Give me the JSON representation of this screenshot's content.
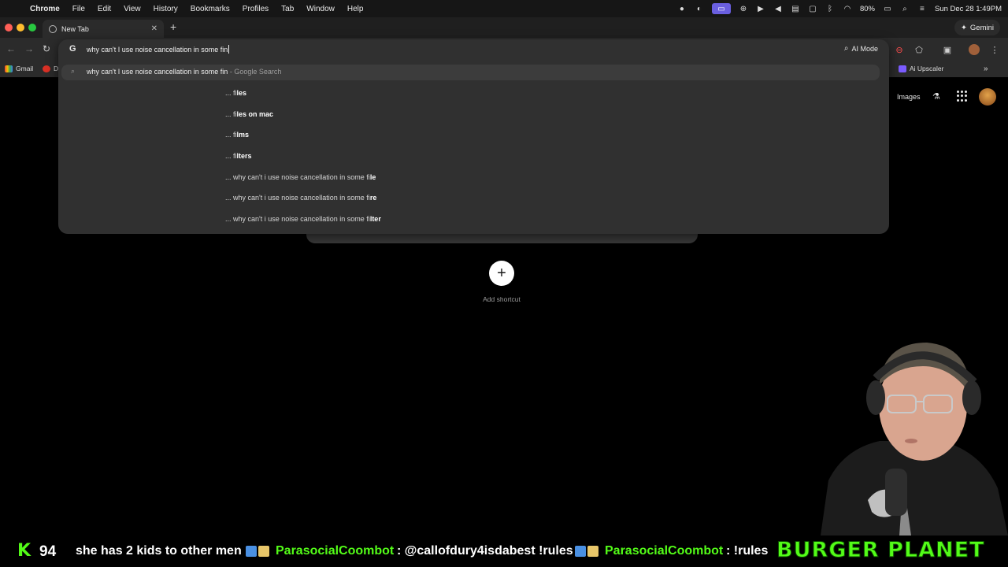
{
  "menubar": {
    "app": "Chrome",
    "items": [
      "File",
      "Edit",
      "View",
      "History",
      "Bookmarks",
      "Profiles",
      "Tab",
      "Window",
      "Help"
    ],
    "battery": "80%",
    "datetime": "Sun Dec 28  1:49PM"
  },
  "tabs": [
    {
      "label": "New Tab"
    }
  ],
  "gemini_label": "Gemini",
  "omnibox": {
    "query": "why can't I use noise cancellation in some fin",
    "ai_mode_label": "AI Mode",
    "top_suggestion": {
      "text": "why can't I use noise cancellation in some fin",
      "source": " - Google Search"
    },
    "suggestions": [
      {
        "prefix": "... fi",
        "completion": "les"
      },
      {
        "prefix": "... fi",
        "completion": "les on mac"
      },
      {
        "prefix": "... fi",
        "completion": "lms"
      },
      {
        "prefix": "... fi",
        "completion": "lters"
      },
      {
        "prefix": "... why can't i use noise cancellation in some fi",
        "completion": "le"
      },
      {
        "prefix": "... why can't i use noise cancellation in some fi",
        "completion": "re"
      },
      {
        "prefix": "... why can't i use noise cancellation in some fi",
        "completion": "lter"
      }
    ]
  },
  "bookmarks": {
    "gmail": "Gmail",
    "clipped": "D",
    "ai_upscaler": "Ai Upscaler"
  },
  "ntp": {
    "images_link": "Images",
    "add_shortcut_label": "Add shortcut",
    "add_shortcut_symbol": "+"
  },
  "stream": {
    "viewer_count": "94",
    "message_tail": "she has 2 kids to other men",
    "chat": [
      {
        "user": "ParasocialCoombot",
        "message": ": @callofdury4isdabest !rules"
      },
      {
        "user": "ParasocialCoombot",
        "message": ": !rules"
      }
    ],
    "brand": "BURGER PLANET",
    "accent": "#53fc18"
  }
}
